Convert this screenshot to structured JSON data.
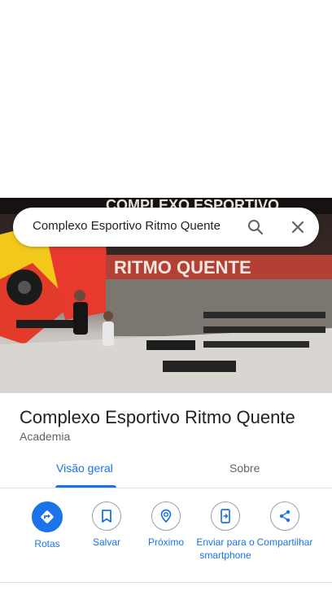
{
  "search": {
    "query": "Complexo Esportivo Ritmo Quente",
    "search_icon": "search-icon",
    "close_icon": "close-icon"
  },
  "photo": {
    "banner_top": "COMPLEXO ESPORTIVO",
    "banner_bottom": "RITMO QUENTE"
  },
  "place": {
    "name": "Complexo Esportivo Ritmo Quente",
    "category": "Academia"
  },
  "tabs": [
    {
      "label": "Visão geral",
      "active": true
    },
    {
      "label": "Sobre",
      "active": false
    }
  ],
  "actions": [
    {
      "label": "Rotas",
      "icon": "directions-icon"
    },
    {
      "label": "Salvar",
      "icon": "bookmark-icon"
    },
    {
      "label": "Próximo",
      "icon": "nearby-icon"
    },
    {
      "label": "Enviar para o smartphone",
      "icon": "send-to-phone-icon"
    },
    {
      "label": "Compartilhar",
      "icon": "share-icon"
    }
  ],
  "colors": {
    "accent": "#1a73e8",
    "text": "#202124",
    "secondary_text": "#5f6368"
  }
}
